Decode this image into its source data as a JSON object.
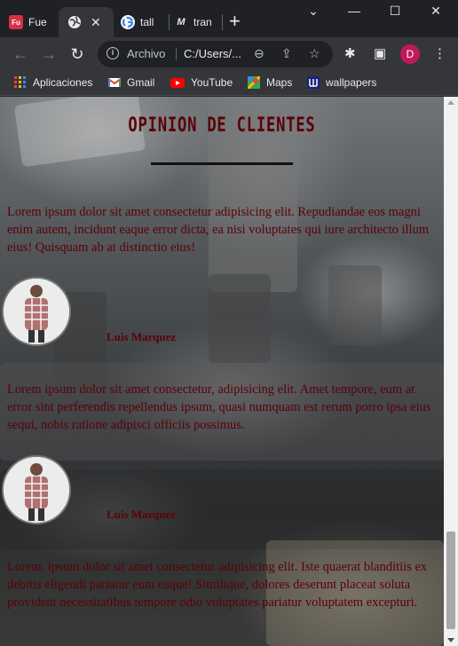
{
  "tabs": [
    {
      "title": "Fue",
      "favicon": "red-logo-icon",
      "active": false
    },
    {
      "title": "",
      "favicon": "globe-icon",
      "active": true
    },
    {
      "title": "tall",
      "favicon": "google-icon",
      "active": false
    },
    {
      "title": "tran",
      "favicon": "m-logo-icon",
      "active": false
    }
  ],
  "toolbar": {
    "security_label": "Archivo",
    "url": "C:/Users/...",
    "profile_initial": "D"
  },
  "bookmarks": [
    {
      "label": "Aplicaciones",
      "icon": "apps-grid-icon"
    },
    {
      "label": "Gmail",
      "icon": "gmail-icon"
    },
    {
      "label": "YouTube",
      "icon": "youtube-icon"
    },
    {
      "label": "Maps",
      "icon": "maps-icon"
    },
    {
      "label": "wallpapers",
      "icon": "wallpapers-icon"
    }
  ],
  "page": {
    "section_title": "OPINION DE CLIENTES",
    "intro_review": "Lorem ipsum dolor sit amet consectetur adipisicing elit. Repudiandae eos magni enim autem, incidunt eaque error dicta, ea nisi voluptates qui iure architecto illum eius! Quisquam ab at distinctio eius!",
    "reviews": [
      {
        "name": "Luis Marquez",
        "text": "Lorem ipsum dolor sit amet consectetur, adipisicing elit. Amet tempore, eum at error sint perferendis repellendus ipsum, quasi numquam est rerum porro ipsa eius sequi, nobis ratione adipisci officiis possimus."
      },
      {
        "name": "Luis Marquez",
        "text": "Lorem, ipsum dolor sit amet consectetur adipisicing elit. Iste quaerat blanditiis ex debitis eligendi pariatur eum eaque! Similique, dolores deserunt placeat soluta provident necessitatibus tempore odio voluptates pariatur voluptatem excepturi."
      }
    ]
  },
  "colors": {
    "text_accent": "#5a0008",
    "browser_dark": "#202124",
    "toolbar": "#35363a"
  }
}
